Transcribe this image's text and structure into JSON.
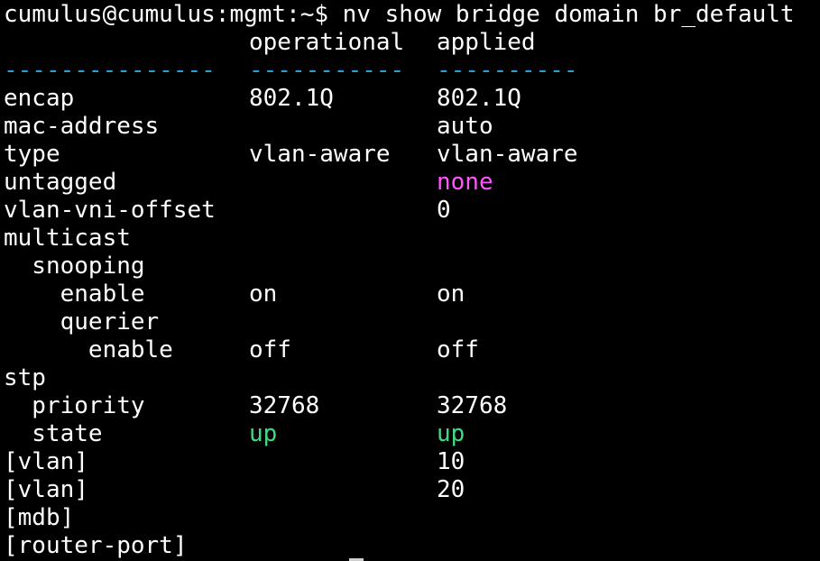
{
  "prompt": "cumulus@cumulus:mgmt:~$ nv show bridge domain br_default",
  "header": {
    "operational": "operational",
    "applied": "applied"
  },
  "separator": {
    "key": "---------------",
    "operational": "-----------",
    "applied": "----------"
  },
  "rows": [
    {
      "key": "encap",
      "operational": "802.1Q",
      "applied": "802.1Q"
    },
    {
      "key": "mac-address",
      "operational": "",
      "applied": "auto"
    },
    {
      "key": "type",
      "operational": "vlan-aware",
      "applied": "vlan-aware"
    },
    {
      "key": "untagged",
      "operational": "",
      "applied": "none"
    },
    {
      "key": "vlan-vni-offset",
      "operational": "",
      "applied": "0"
    },
    {
      "key": "multicast",
      "operational": "",
      "applied": ""
    },
    {
      "key": "  snooping",
      "operational": "",
      "applied": ""
    },
    {
      "key": "    enable",
      "operational": "on",
      "applied": "on"
    },
    {
      "key": "    querier",
      "operational": "",
      "applied": ""
    },
    {
      "key": "      enable",
      "operational": "off",
      "applied": "off"
    },
    {
      "key": "stp",
      "operational": "",
      "applied": ""
    },
    {
      "key": "  priority",
      "operational": "32768",
      "applied": "32768"
    },
    {
      "key": "  state",
      "operational": "up",
      "applied": "up"
    },
    {
      "key": "[vlan]",
      "operational": "",
      "applied": "10"
    },
    {
      "key": "[vlan]",
      "operational": "",
      "applied": "20"
    },
    {
      "key": "[mdb]",
      "operational": "",
      "applied": ""
    },
    {
      "key": "[router-port]",
      "operational": "",
      "applied": ""
    }
  ],
  "colors": {
    "background": "#000000",
    "text": "#ffffff",
    "separator": "#2a9fd6",
    "none_value": "#ff55ff",
    "up_value": "#3ddc84"
  }
}
